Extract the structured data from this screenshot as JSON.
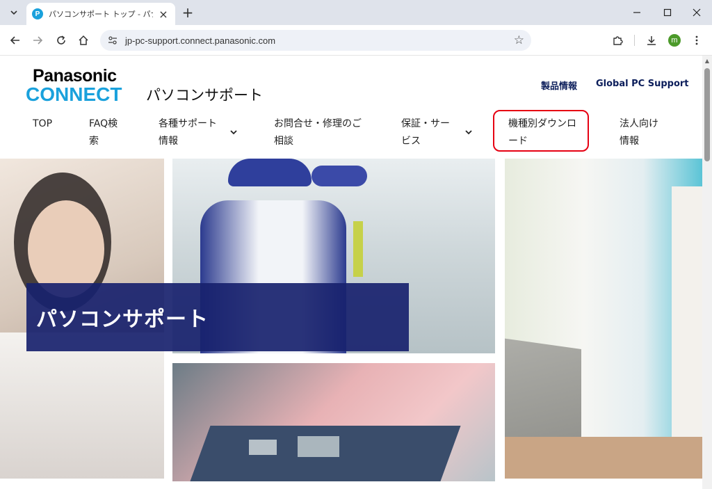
{
  "browser": {
    "tab_title": "パソコンサポート トップ - パナソニック",
    "favicon_letter": "P",
    "url": "jp-pc-support.connect.panasonic.com",
    "avatar_letter": "m"
  },
  "header": {
    "logo_top": "Panasonic",
    "logo_bottom": "CONNECT",
    "site_title": "パソコンサポート",
    "links": [
      "製品情報",
      "Global PC Support"
    ]
  },
  "nav": {
    "items": [
      {
        "line1": "TOP",
        "line2": ""
      },
      {
        "line1": "FAQ検",
        "line2": "索"
      },
      {
        "line1": "各種サポート",
        "line2": "情報"
      },
      {
        "line1": "お問合せ・修理のご",
        "line2": "相談"
      },
      {
        "line1": "保証・サー",
        "line2": "ビス"
      },
      {
        "line1": "機種別ダウンロ",
        "line2": "ード"
      },
      {
        "line1": "法人向け",
        "line2": "情報"
      }
    ],
    "highlighted_index": 5,
    "highlight_color": "#e60012"
  },
  "hero": {
    "title": "パソコンサポート",
    "band_color": "#18226e"
  },
  "colors": {
    "brand_blue": "#1aa1dc",
    "link_navy": "#0c1e5b"
  }
}
